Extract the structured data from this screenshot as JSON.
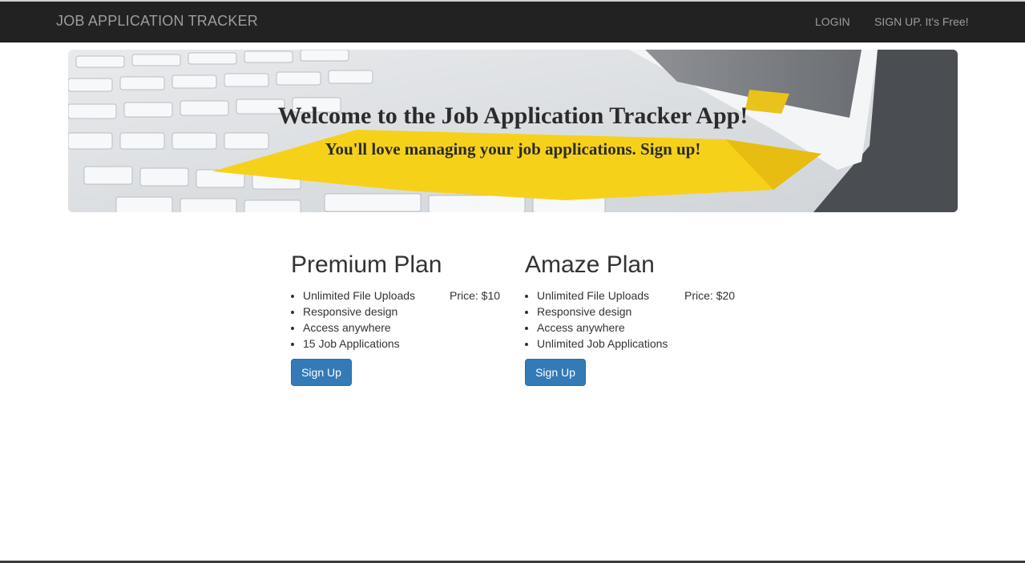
{
  "navbar": {
    "brand": "JOB APPLICATION TRACKER",
    "links": [
      "LOGIN",
      "SIGN UP. It's Free!"
    ],
    "background": "#222222",
    "link_color": "#9d9d9d"
  },
  "hero": {
    "title": "Welcome to the Job Application Tracker App!",
    "subtitle": "You'll love managing your job applications. Sign up!",
    "image": "laptop-keyboard-sticky-note"
  },
  "plans": [
    {
      "name": "Premium Plan",
      "price": "Price: $10",
      "features": [
        "Unlimited File Uploads",
        "Responsive design",
        "Access anywhere",
        "15 Job Applications"
      ],
      "button": "Sign Up"
    },
    {
      "name": "Amaze Plan",
      "price": "Price: $20",
      "features": [
        "Unlimited File Uploads",
        "Responsive design",
        "Access anywhere",
        "Unlimited Job Applications"
      ],
      "button": "Sign Up"
    }
  ],
  "colors": {
    "accent": "#337ab7",
    "text": "#333333"
  }
}
